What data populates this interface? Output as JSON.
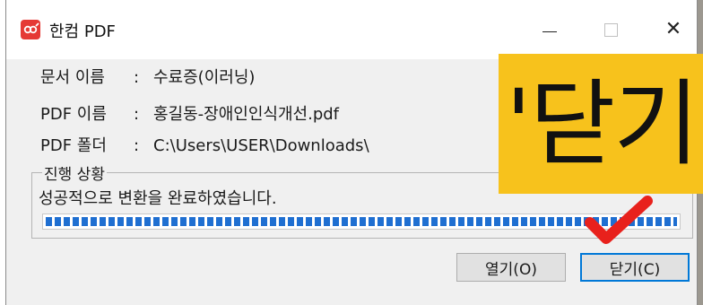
{
  "window": {
    "title": "한컴 PDF",
    "minimize_icon": "minimize-icon",
    "maximize_icon": "maximize-icon",
    "close_icon": "close-icon",
    "close_glyph": "✕"
  },
  "info": {
    "doc_name_label": "문서 이름",
    "doc_name_value": "수료증(이러닝)",
    "pdf_name_label": "PDF 이름",
    "pdf_name_value": "홍길동-장애인인식개선.pdf",
    "pdf_folder_label": "PDF 폴더",
    "pdf_folder_value": "C:\\Users\\USER\\Downloads\\",
    "separator": ":"
  },
  "progress": {
    "group_label": "진행 상황",
    "status": "성공적으로 변환을 완료하였습니다.",
    "percent": 100
  },
  "buttons": {
    "open_label": "열기(O)",
    "close_label": "닫기(C)"
  },
  "annotation": {
    "callout_text": "'닫기",
    "callout_color": "#f7c21c",
    "checkmark_color": "#e8211c"
  },
  "colors": {
    "progress_fill": "#1f6fd1",
    "focus_border": "#0078d7",
    "app_icon": "#e53935"
  }
}
